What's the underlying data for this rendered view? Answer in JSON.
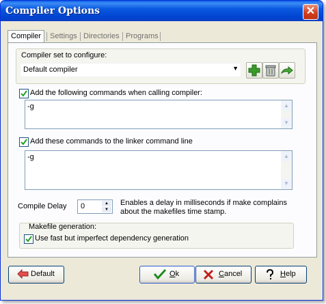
{
  "window": {
    "title": "Compiler Options",
    "close_glyph": "✕"
  },
  "tabs": [
    "Compiler",
    "Settings",
    "Directories",
    "Programs"
  ],
  "compiler_set": {
    "label": "Compiler set to configure:",
    "selected": "Default compiler",
    "icons": [
      "add-icon",
      "delete-icon",
      "rename-icon"
    ]
  },
  "compiler_commands": {
    "checked": true,
    "label": "Add the following commands when calling compiler:",
    "value": "-g"
  },
  "linker_commands": {
    "checked": true,
    "label": "Add these commands to the linker command line",
    "value": "-g"
  },
  "compile_delay": {
    "label": "Compile Delay",
    "value": "0",
    "description_line1": "Enables a delay in milliseconds if make complains",
    "description_line2": "about the makefiles time stamp."
  },
  "makefile": {
    "group_label": "Makefile generation:",
    "checked": true,
    "option_label": "Use fast but imperfect dependency generation"
  },
  "buttons": {
    "default": "Default",
    "ok_u": "O",
    "ok_rest": "k",
    "cancel_u": "C",
    "cancel_rest": "ancel",
    "help_u": "H",
    "help_rest": "elp"
  },
  "colors": {
    "title_bar": "#0a58e0",
    "add": "#3a9a2a",
    "cancel_x": "#c0201a",
    "ok_check": "#1e8a1e"
  }
}
